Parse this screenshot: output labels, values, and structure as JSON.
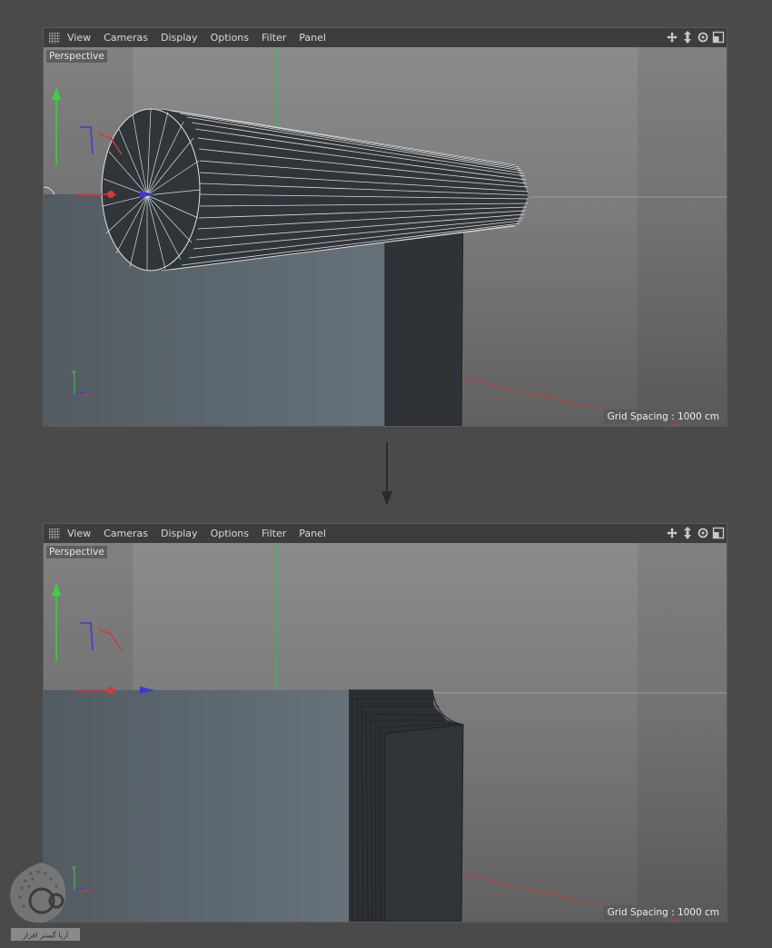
{
  "menu": {
    "view": "View",
    "cameras": "Cameras",
    "display": "Display",
    "options": "Options",
    "filter": "Filter",
    "panel": "Panel"
  },
  "nav_icons": [
    "move-icon",
    "zoom-icon",
    "rotate-icon",
    "maximize-icon"
  ],
  "viewport_top": {
    "label": "Perspective",
    "grid_spacing": "Grid Spacing : 1000 cm",
    "axis_label": "Y"
  },
  "viewport_bottom": {
    "label": "Perspective",
    "grid_spacing": "Grid Spacing : 1000 cm",
    "axis_label": "Y"
  },
  "colors": {
    "background": "#4a4a4a",
    "viewport_bg": "#6f6f6f",
    "object_face": "#5d6870",
    "object_dark": "#2f3337",
    "wire": "#e8e8e8",
    "x_axis": "#d33a3a",
    "y_axis": "#3fd03f",
    "z_axis": "#3a3ad8"
  },
  "watermark_text": "آریا گستر افزار"
}
